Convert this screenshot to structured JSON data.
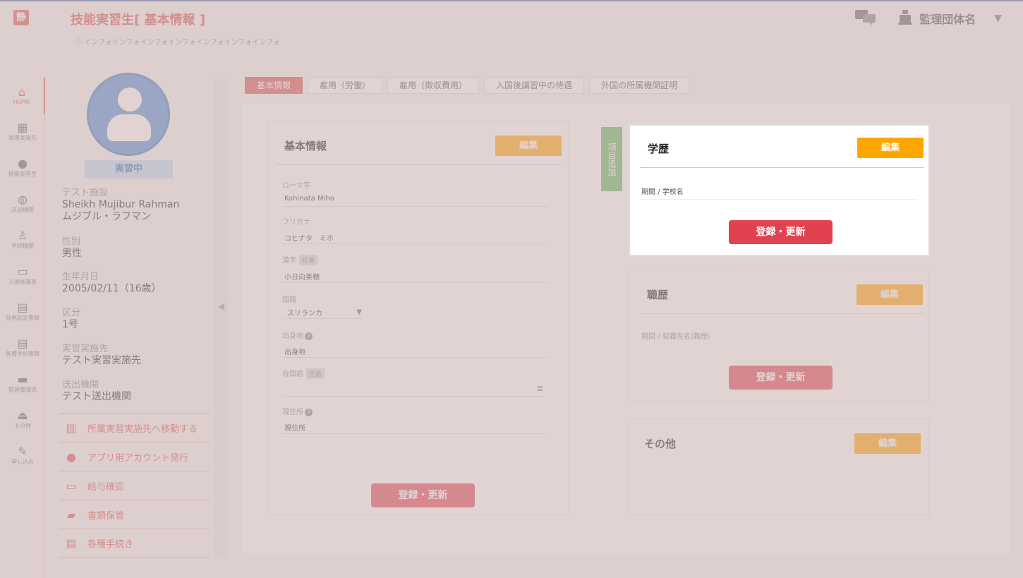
{
  "header": {
    "logo": "静",
    "title": "技能実習生[ 基本情報 ]",
    "subtitle": "ⓘ インフォインフォインフォインフォインフォインフォインフォ",
    "org_name": "監理団体名",
    "org_caret": "▼"
  },
  "nav": [
    {
      "label": "HOME",
      "glyph": "⌂"
    },
    {
      "label": "実習実施先",
      "glyph": "▦"
    },
    {
      "label": "技能実習生",
      "glyph": "●"
    },
    {
      "label": "送出機関",
      "glyph": "◍"
    },
    {
      "label": "手続機関",
      "glyph": "♙"
    },
    {
      "label": "入国後講習",
      "glyph": "▭"
    },
    {
      "label": "計画認定書類",
      "glyph": "▤"
    },
    {
      "label": "各種手続書類",
      "glyph": "▤"
    },
    {
      "label": "監理費請求",
      "glyph": "▬"
    },
    {
      "label": "その他",
      "glyph": "⏏"
    },
    {
      "label": "申し込み",
      "glyph": "✎"
    }
  ],
  "profile": {
    "status": "実習中",
    "facility_label": "テスト施設",
    "name_en": "Sheikh Mujibur Rahman",
    "name_kana": "ムジブル・ラフマン",
    "gender_label": "性別",
    "gender": "男性",
    "dob_label": "生年月日",
    "dob": "2005/02/11（16歳）",
    "class_label": "区分",
    "class": "1号",
    "site_label": "実習実施先",
    "site": "テスト実習実施先",
    "agency_label": "送出機関",
    "agency": "テスト送出機関"
  },
  "actions": [
    {
      "label": "所属実習実施先へ移動する",
      "glyph": "▥"
    },
    {
      "label": "アプリ用アカウント発行",
      "glyph": "●"
    },
    {
      "label": "給与確認",
      "glyph": "▭"
    },
    {
      "label": "書類保管",
      "glyph": "▰"
    },
    {
      "label": "各種手続き",
      "glyph": "▤"
    }
  ],
  "tabs": [
    "基本情報",
    "雇用（労働）",
    "雇用（徴収費用）",
    "入国後講習中の待遇",
    "外国の所属機関証明"
  ],
  "basic": {
    "title": "基本情報",
    "edit": "編集",
    "romaji_label": "ローマ字",
    "romaji": "Kohinata Miho",
    "furigana_label": "フリガナ",
    "furigana": "コヒナタ　ミホ",
    "kanji_label": "漢字",
    "optional": "任意",
    "kanji": "小日向美穂",
    "nationality_label": "国籍",
    "nationality": "スリランカ",
    "birthplace_label": "出身地",
    "birthplace": "出身地",
    "mother_tongue_label": "母国語",
    "address_label": "現住所",
    "address": "現住所",
    "save": "登録・更新"
  },
  "add_item": "項目追加",
  "education": {
    "title": "学歴",
    "edit": "編集",
    "field_label": "期間 / 学校名",
    "save": "登録・更新"
  },
  "career": {
    "title": "職歴",
    "edit": "編集",
    "field_label": "期間 / 就職先名(職歴)",
    "save": "登録・更新"
  },
  "other": {
    "title": "その他",
    "edit": "編集"
  },
  "colors": {
    "accent": "#d9534f",
    "edit": "#ffa500",
    "save": "#e0424f",
    "add": "#5cb85c"
  }
}
